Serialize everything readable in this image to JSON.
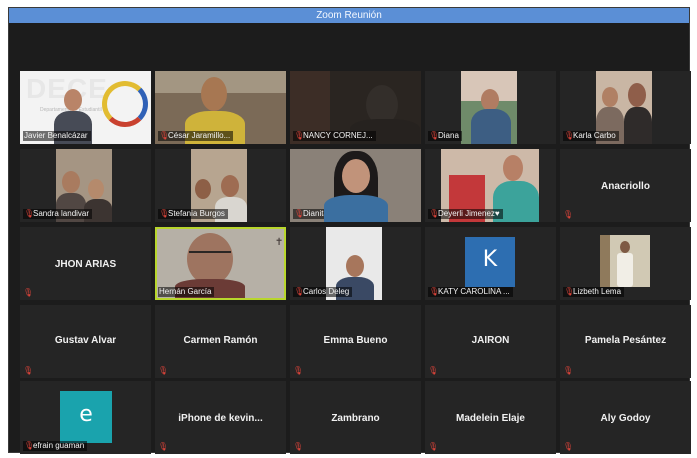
{
  "window": {
    "title": "Zoom Reunión"
  },
  "icons": {
    "muted": "mic-muted-icon"
  },
  "colors": {
    "titlebar": "#5b8fd6",
    "active_speaker_border": "#b8d62c",
    "muted_icon": "#e0443a"
  },
  "gallery": {
    "row1": [
      {
        "name": "Javier Benalcázar",
        "banner_text": "DECE",
        "banner_subtext": "Departamento ... Estudiantil"
      },
      {
        "name": "César Jaramillo..."
      },
      {
        "name": "NANCY CORNEJ..."
      },
      {
        "name": "Diana"
      },
      {
        "name": "Karla Carbo"
      }
    ],
    "row2": [
      {
        "name": "Sandra landivar"
      },
      {
        "name": "Stefania Burgos"
      },
      {
        "name": "Dianita Becerra"
      },
      {
        "name": "Deyerli Jimenez♥"
      },
      {
        "name": "Anacriollo"
      }
    ],
    "row3": [
      {
        "name": "JHON ARIAS"
      },
      {
        "name": "Hernán García"
      },
      {
        "name": "Carlos Deleg"
      },
      {
        "name": "KATY CAROLINA ...",
        "avatar_letter": "K"
      },
      {
        "name": "Lizbeth Lema"
      }
    ],
    "row4": [
      {
        "name": "Gustav Alvar"
      },
      {
        "name": "Carmen Ramón"
      },
      {
        "name": "Emma Bueno"
      },
      {
        "name": "JAIRON"
      },
      {
        "name": "Pamela Pesántez"
      }
    ],
    "row5": [
      {
        "name": "efrain guaman",
        "avatar_letter": "e"
      },
      {
        "name": "iPhone de kevin..."
      },
      {
        "name": "Zambrano"
      },
      {
        "name": "Madelein Elaje"
      },
      {
        "name": "Aly Godoy"
      }
    ]
  }
}
